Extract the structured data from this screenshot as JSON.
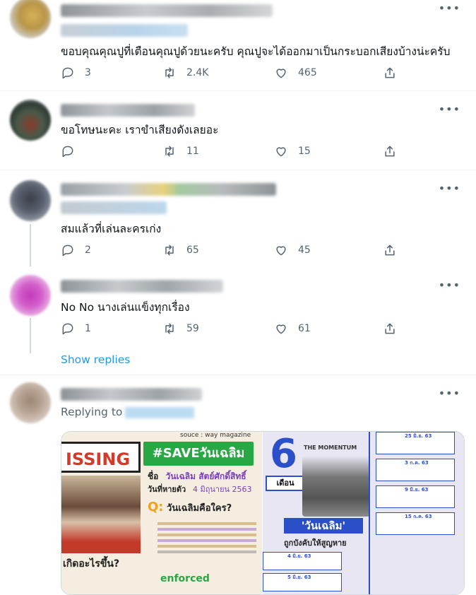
{
  "tweets": [
    {
      "text": "ขอบคุณคุณปูที่เตือนคุณปูด้วยนะครับ คุณปูจะได้ออกมาเป็นกระบอกเสียงบ้างน่ะครับ",
      "replies": "3",
      "retweets": "2.4K",
      "likes": "465"
    },
    {
      "text": "ขอโทษนะคะ เราขำเสียงดังเลยอะ",
      "replies": "",
      "retweets": "11",
      "likes": "15"
    },
    {
      "text": "สมแล้วที่เล่นละครเก่ง",
      "replies": "2",
      "retweets": "65",
      "likes": "45"
    },
    {
      "text": "No No นางเล่นแข็งทุกเรื่อง",
      "replies": "1",
      "retweets": "59",
      "likes": "61"
    }
  ],
  "show_replies": "Show replies",
  "last_tweet": {
    "replying_label": "Replying to"
  },
  "media": {
    "left": {
      "missing": "ISSING",
      "source": "souce : way magazine",
      "headline": "#SAVEวันเฉลิม",
      "name_label": "ชื่อ",
      "name": "วันเฉลิม  สัตย์ศักดิ์สิทธิ์",
      "date_label": "วันที่หายตัว",
      "date": "4 มิถุนายน 2563",
      "q_label": "วันเฉลิมคือใคร?",
      "q_prefix": "Q:",
      "happened": "เกิดอะไรขึ้น?",
      "enforced": "enforced"
    },
    "right": {
      "number": "6",
      "month": "เดือน",
      "brand": "THE MOMENTUM",
      "title": "'วันเฉลิม'",
      "subtitle": "ถูกบังคับให้สูญหาย",
      "timeline": [
        "25 มิ.ย. 63",
        "3 ก.ค. 63",
        "9 มิ.ย. 63",
        "15 ก.ค. 63",
        "4 มิ.ย. 63",
        "5 มิ.ย. 63"
      ]
    }
  },
  "colors": {
    "accent": "#1d9bf0",
    "muted": "#536471"
  }
}
